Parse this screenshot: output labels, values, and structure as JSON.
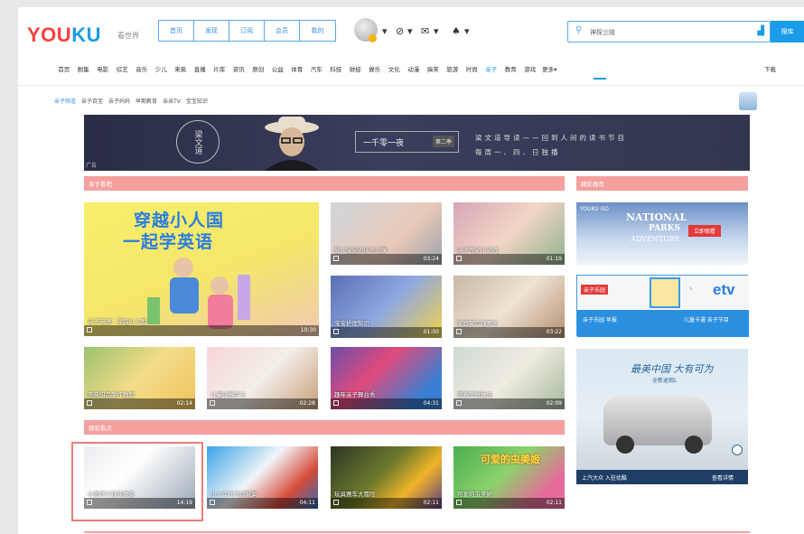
{
  "header": {
    "logo_you": "YOU",
    "logo_ku": "KU",
    "logo_sub": "看世界",
    "top_nav": [
      "首页",
      "发现",
      "订阅",
      "会员",
      "我的"
    ],
    "search_placeholder": "神探兰陵",
    "search_button": "搜库"
  },
  "category_nav": {
    "items": [
      "首页",
      "剧集",
      "电影",
      "综艺",
      "音乐",
      "少儿",
      "来疯",
      "直播",
      "片库",
      "资讯",
      "原创",
      "公益",
      "体育",
      "汽车",
      "科技",
      "财经",
      "娱乐",
      "文化",
      "动漫",
      "搞笑",
      "旅游",
      "时尚",
      "亲子",
      "教育",
      "游戏",
      "更多▾"
    ],
    "active": "亲子",
    "download": "下载"
  },
  "sub_nav": {
    "items": [
      "亲子频道",
      "亲子百宝",
      "亲子妈妈",
      "早期教育",
      "亲亲TV",
      "宝宝知识"
    ]
  },
  "banner": {
    "circle_text": "梁文道",
    "box_title": "一千零一夜",
    "box_episode": "第二季",
    "tagline_1": "梁文道导读——回到人间的读书节目",
    "tagline_2": "每周一、四、日独播",
    "corner_badge": "广告"
  },
  "sections": {
    "left_title": "亲子看吧",
    "right_title": "精彩推荐",
    "second_title": "精彩看点"
  },
  "featured": {
    "headline_line1": "穿越小人国",
    "headline_line2": "一起学英语",
    "caption": "亲子英语：穿越小人国",
    "duration": "10:30"
  },
  "grid_videos": [
    {
      "caption": "婴儿宝宝的成长记录",
      "duration": "03:24"
    },
    {
      "caption": "亲子互动小游戏",
      "duration": "01:19"
    },
    {
      "caption": "宝宝护理知识",
      "duration": "01:00"
    },
    {
      "caption": "家庭聚会趣事多",
      "duration": "03:22"
    },
    {
      "caption": "美味甜品制作教程",
      "duration": "02:14"
    },
    {
      "caption": "儿童创意手工",
      "duration": "02:28"
    },
    {
      "caption": "趣味亲子舞台秀",
      "duration": "04:31"
    },
    {
      "caption": "营养早餐做法",
      "duration": "02:09"
    }
  ],
  "bottom_videos": [
    {
      "caption": "小厨师们趣味做菜",
      "duration": "14:19"
    },
    {
      "caption": "小火车托马斯玩具",
      "duration": "04:11"
    },
    {
      "caption": "玩具赛车大冒险",
      "duration": "02:11"
    },
    {
      "caption": "可爱的虫美姬",
      "duration": "02:11",
      "overlay": "可爱的虫美姬"
    }
  ],
  "ads": {
    "np_logo": "YOUKU GO",
    "np_t1": "NATIONAL",
    "np_t2": "PARKS",
    "np_t3": "ADVENTURE",
    "np_btn": "立即观看",
    "tv_red": "亲子乐园",
    "tv_etv": "tv",
    "tv_bottom_left": "亲子乐园 早报",
    "tv_bottom_right": "儿童卡通 亲子节目",
    "car_title": "最美中国 大有可为",
    "car_sub": "全新途观L",
    "car_foot_left": "上汽大众 入驻优酷",
    "car_foot_right": "查看详情"
  },
  "colors": {
    "brand_red": "#ff3d3d",
    "brand_blue": "#1a9ce8",
    "section_pink": "#f3a09e",
    "highlight": "#ef7b7b"
  }
}
